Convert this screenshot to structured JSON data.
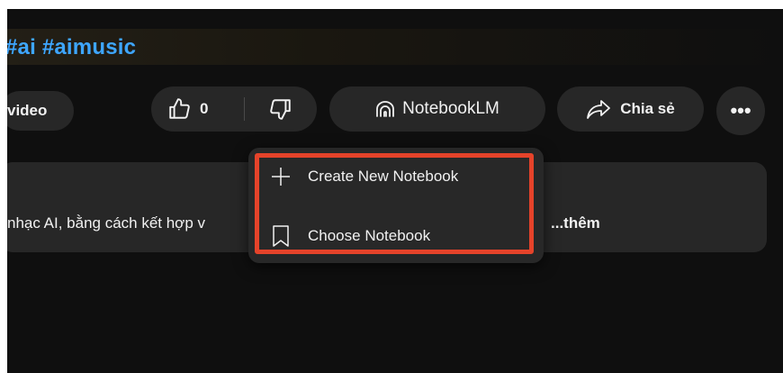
{
  "video": {
    "hashtags": "#ai #aimusic",
    "video_pill_label": "video",
    "like_count": "0",
    "notebook_label": "NotebookLM",
    "share_label": "Chia sẻ",
    "more_label": "•••",
    "description_text": "nhạc AI, bằng cách kết hợp v",
    "description_more": "...thêm"
  },
  "menu": {
    "items": [
      {
        "label": "Create New Notebook",
        "icon": "plus-icon"
      },
      {
        "label": "Choose Notebook",
        "icon": "bookmark-icon"
      }
    ]
  },
  "colors": {
    "background": "#0f0f0f",
    "pill": "#272727",
    "link": "#3ea6ff",
    "highlight": "#e5432a"
  }
}
